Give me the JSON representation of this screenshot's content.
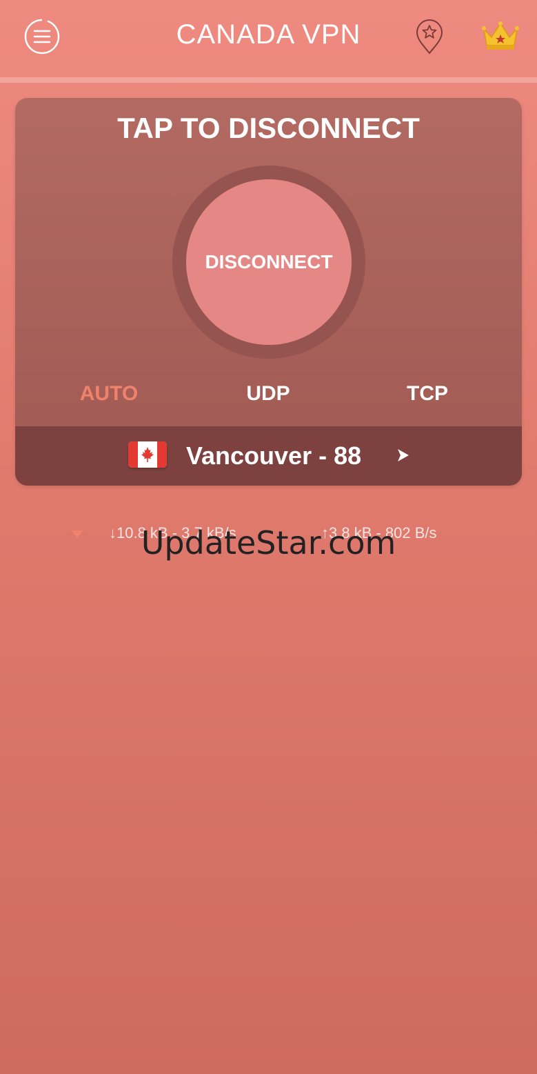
{
  "header": {
    "title": "CANADA VPN",
    "menu_icon": "menu-icon",
    "location_icon": "location-star-icon",
    "premium_icon": "crown-icon"
  },
  "card": {
    "title": "TAP TO DISCONNECT",
    "button_label": "DISCONNECT",
    "protocols": [
      {
        "label": "AUTO",
        "selected": true
      },
      {
        "label": "UDP",
        "selected": false
      },
      {
        "label": "TCP",
        "selected": false
      }
    ],
    "server": {
      "flag": "canada-flag-icon",
      "name": "Vancouver - 88"
    }
  },
  "stats": {
    "download": "↓10.8 kB - 3.7 kB/s",
    "upload": "↑3.8 kB - 802 B/s"
  },
  "watermark": "UpdateStar.com",
  "colors": {
    "accent": "#f0826c",
    "button": "#e58784",
    "server_bar": "#7d423f"
  }
}
